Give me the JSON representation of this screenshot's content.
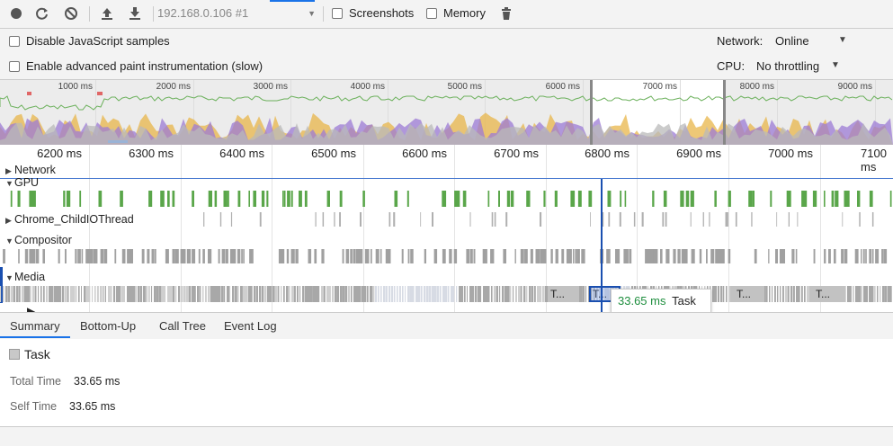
{
  "toolbar": {
    "target": "192.168.0.106 #1",
    "screenshots_label": "Screenshots",
    "memory_label": "Memory",
    "icons": [
      "record-icon",
      "reload-icon",
      "clear-icon",
      "upload-icon",
      "download-icon",
      "trash-icon"
    ]
  },
  "settings": {
    "disable_js_samples": "Disable JavaScript samples",
    "advanced_paint": "Enable advanced paint instrumentation (slow)",
    "network_label": "Network:",
    "network_value": "Online",
    "cpu_label": "CPU:",
    "cpu_value": "No throttling"
  },
  "overview": {
    "ticks": [
      "1000 ms",
      "2000 ms",
      "3000 ms",
      "4000 ms",
      "5000 ms",
      "6000 ms",
      "7000 ms",
      "8000 ms",
      "9000 ms"
    ]
  },
  "ruler": {
    "ticks": [
      "6200 ms",
      "6300 ms",
      "6400 ms",
      "6500 ms",
      "6600 ms",
      "6700 ms",
      "6800 ms",
      "6900 ms",
      "7000 ms",
      "7100 ms"
    ]
  },
  "tracks": {
    "network": "Network",
    "gpu": "GPU",
    "io_thread": "Chrome_ChildIOThread",
    "compositor": "Compositor",
    "media": "Media",
    "task_labels": [
      "T...",
      "T...",
      "T...",
      "T..."
    ]
  },
  "tooltip": {
    "duration": "33.65 ms",
    "name": "Task"
  },
  "tabs": [
    "Summary",
    "Bottom-Up",
    "Call Tree",
    "Event Log"
  ],
  "summary": {
    "title": "Task",
    "total_time_label": "Total Time",
    "total_time_value": "33.65 ms",
    "self_time_label": "Self Time",
    "self_time_value": "33.65 ms"
  },
  "colors": {
    "gpu_green": "#5aa64a",
    "selection_blue": "#1a4fb0",
    "task_gray": "#a8a8a8",
    "tooltip_green": "#1e8e3e"
  }
}
